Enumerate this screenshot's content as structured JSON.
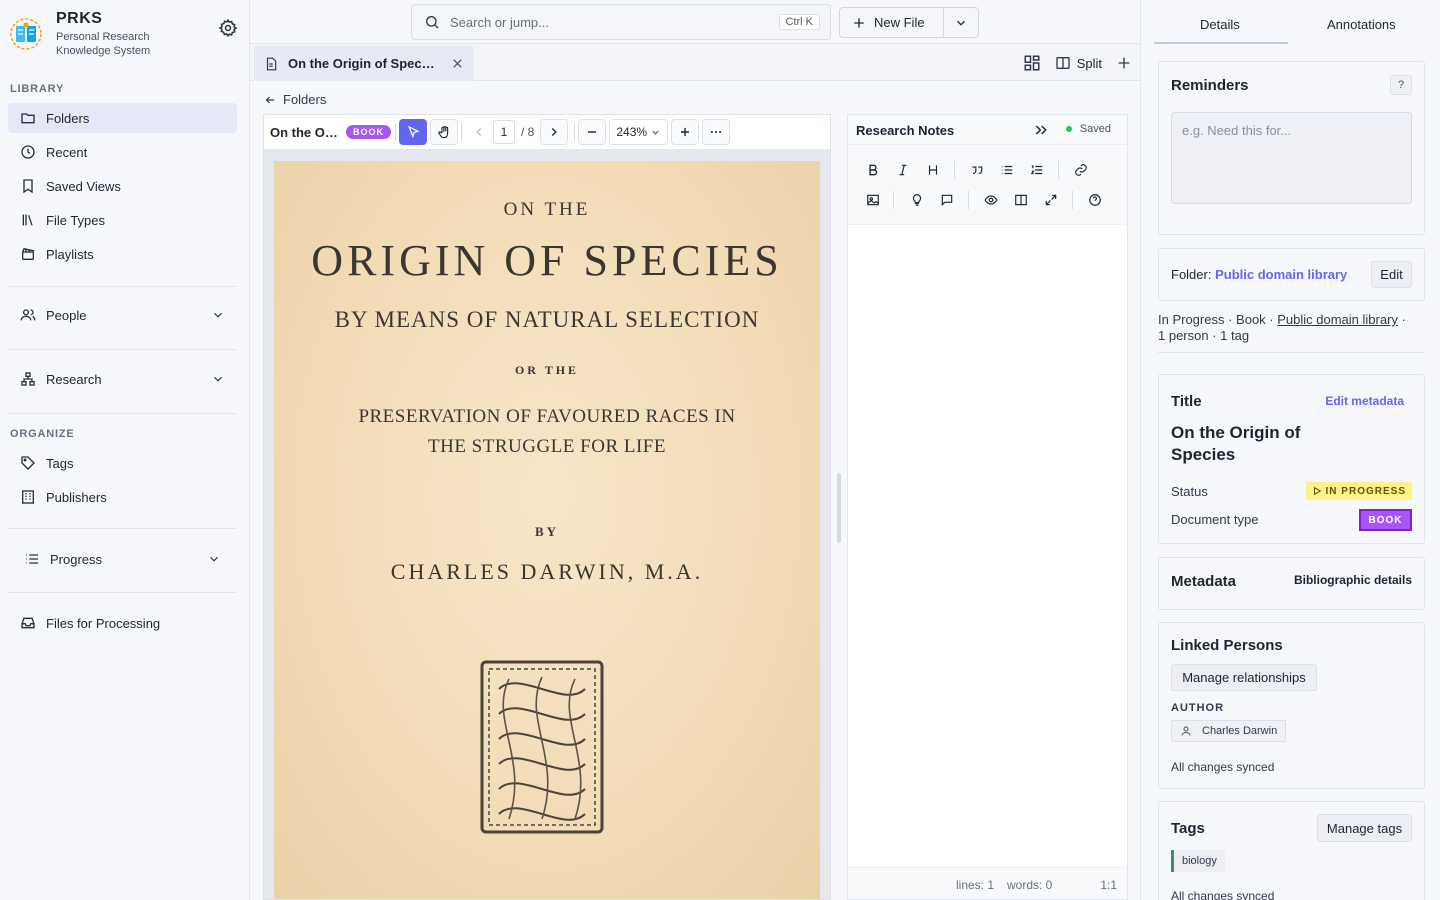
{
  "app": {
    "name": "PRKS",
    "subtitle_line1": "Personal Research",
    "subtitle_line2": "Knowledge System"
  },
  "sidebar": {
    "library_label": "LIBRARY",
    "items": [
      {
        "label": "Folders",
        "icon": "folder-icon"
      },
      {
        "label": "Recent",
        "icon": "clock-icon"
      },
      {
        "label": "Saved Views",
        "icon": "bookmark-icon"
      },
      {
        "label": "File Types",
        "icon": "library-icon"
      },
      {
        "label": "Playlists",
        "icon": "clapperboard-icon"
      }
    ],
    "people_label": "People",
    "research_label": "Research",
    "organize_label": "ORGANIZE",
    "tags_label": "Tags",
    "publishers_label": "Publishers",
    "progress_label": "Progress",
    "files_processing_label": "Files for Processing"
  },
  "topbar": {
    "search_placeholder": "Search or jump...",
    "search_shortcut": "Ctrl K",
    "new_file_label": "New File"
  },
  "tabs": {
    "open_tab_title": "On the Origin of Species",
    "split_label": "Split"
  },
  "breadcrumb": {
    "label": "Folders"
  },
  "viewer": {
    "doc_title": "On the Origin of Species",
    "doc_badge": "BOOK",
    "page_current": "1",
    "page_total": "/ 8",
    "zoom": "243%",
    "page_text": {
      "line1": "ON THE",
      "line2": "ORIGIN OF SPECIES",
      "line3": "BY MEANS OF NATURAL SELECTION",
      "line4": "OR THE",
      "line5": "PRESERVATION OF FAVOURED RACES IN",
      "line6": "THE STRUGGLE FOR LIFE",
      "line7": "BY",
      "line8": "CHARLES DARWIN, M.A."
    }
  },
  "notes": {
    "title": "Research Notes",
    "save_status": "Saved",
    "lines": "lines: 1",
    "words": "words: 0",
    "cursor": "1:1"
  },
  "details": {
    "tab_details": "Details",
    "tab_annotations": "Annotations",
    "reminders_title": "Reminders",
    "reminders_help": "?",
    "reminders_placeholder": "e.g. Need this for...",
    "folder_prefix": "Folder:",
    "folder_name": "Public domain library",
    "folder_edit": "Edit",
    "summary_status": "In Progress",
    "summary_type": "Book",
    "summary_folder": "Public domain library",
    "summary_counts": "1 person · 1 tag",
    "title_heading": "Title",
    "edit_metadata": "Edit metadata",
    "title_value": "On the Origin of Species",
    "status_label": "Status",
    "status_value": "IN PROGRESS",
    "doctype_label": "Document type",
    "doctype_value": "BOOK",
    "metadata_heading": "Metadata",
    "bibliographic_label": "Bibliographic details",
    "linked_heading": "Linked Persons",
    "manage_relationships": "Manage relationships",
    "author_label": "AUTHOR",
    "author_name": "Charles Darwin",
    "linked_synced": "All changes synced",
    "tags_heading": "Tags",
    "manage_tags": "Manage tags",
    "tag": "biology",
    "tags_synced": "All changes synced"
  },
  "colors": {
    "accent": "#6366f1",
    "book_badge": "#a855f7",
    "status_badge": "#fef08a",
    "saved_dot": "#22c55e",
    "tag_stripe": "#3f8a6b"
  }
}
